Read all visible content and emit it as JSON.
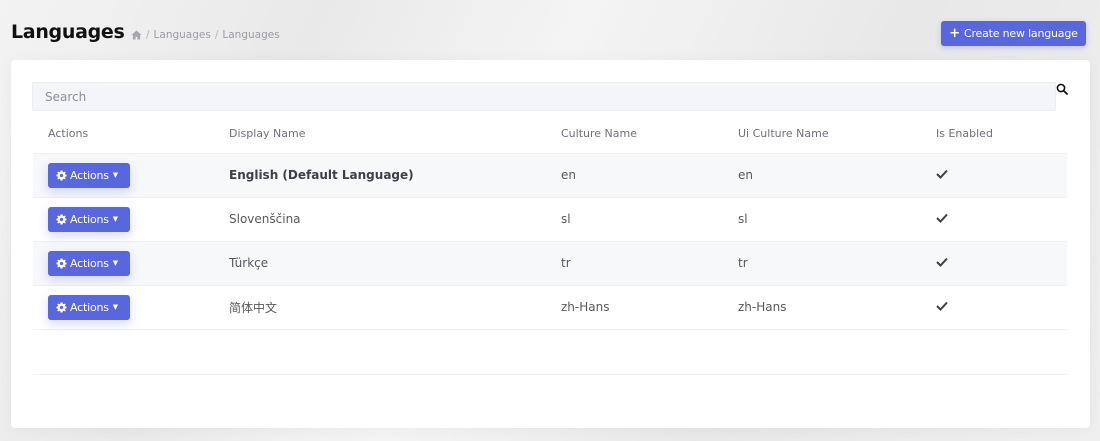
{
  "header": {
    "title": "Languages",
    "breadcrumb": [
      "Languages",
      "Languages"
    ],
    "breadcrumb_separator": "/",
    "create_button_label": "Create new language",
    "accent_color": "#5867dd"
  },
  "search": {
    "placeholder": "Search",
    "value": ""
  },
  "table": {
    "columns": [
      "Actions",
      "Display Name",
      "Culture Name",
      "Ui Culture Name",
      "Is Enabled"
    ],
    "action_label": "Actions",
    "rows": [
      {
        "display_name": "English (Default Language)",
        "culture_name": "en",
        "ui_culture_name": "en",
        "is_enabled": true
      },
      {
        "display_name": "Slovenščina",
        "culture_name": "sl",
        "ui_culture_name": "sl",
        "is_enabled": true
      },
      {
        "display_name": "Türkçe",
        "culture_name": "tr",
        "ui_culture_name": "tr",
        "is_enabled": true
      },
      {
        "display_name": "简体中文",
        "culture_name": "zh-Hans",
        "ui_culture_name": "zh-Hans",
        "is_enabled": true
      }
    ]
  },
  "icons": {
    "home": "home-icon",
    "search": "search-icon",
    "gear": "gear-icon",
    "check": "check-icon",
    "plus": "plus-icon",
    "caret": "caret-down-icon"
  }
}
